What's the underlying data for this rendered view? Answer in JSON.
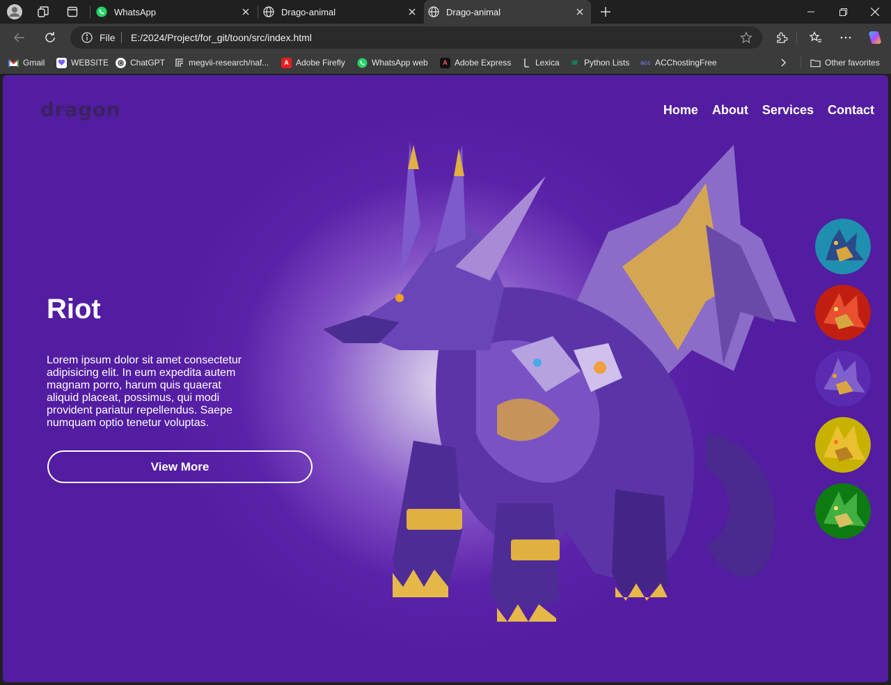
{
  "browser": {
    "tabs": [
      {
        "title": "WhatsApp",
        "icon": "whatsapp-icon",
        "active": false
      },
      {
        "title": "Drago-animal",
        "icon": "globe-icon",
        "active": false
      },
      {
        "title": "Drago-animal",
        "icon": "globe-icon",
        "active": true
      }
    ],
    "omnibox": {
      "scheme_label": "File",
      "url": "E:/2024/Project/for_git/toon/src/index.html"
    },
    "bookmarks": [
      {
        "label": "Gmail",
        "icon": "gmail-icon",
        "color": "#ea4335"
      },
      {
        "label": "WEBSITE",
        "icon": "heart-icon",
        "color": "#7b5cff"
      },
      {
        "label": "ChatGPT",
        "icon": "chatgpt-icon",
        "color": "#ffffff"
      },
      {
        "label": "megvii-research/naf...",
        "icon": "github-icon",
        "color": "#ffffff"
      },
      {
        "label": "Adobe Firefly",
        "icon": "adobe-firefly-icon",
        "color": "#e61e1e"
      },
      {
        "label": "WhatsApp web",
        "icon": "whatsapp-icon",
        "color": "#25d366"
      },
      {
        "label": "Adobe Express",
        "icon": "adobe-express-icon",
        "color": "#111111"
      },
      {
        "label": "Lexica",
        "icon": "lexica-icon",
        "color": "#ffffff"
      },
      {
        "label": "Python Lists",
        "icon": "w3schools-icon",
        "color": "#04aa6d"
      },
      {
        "label": "ACChostingFree",
        "icon": "acc-icon",
        "color": "#6b6bd6"
      }
    ],
    "other_favorites": "Other favorites"
  },
  "page": {
    "logo": "dragon",
    "nav": [
      "Home",
      "About",
      "Services",
      "Contact"
    ],
    "hero": {
      "title": "Riot",
      "description": "Lorem ipsum dolor sit amet consectetur adipisicing elit. In eum expedita autem magnam porro, harum quis quaerat aliquid placeat, possimus, qui modi provident pariatur repellendus. Saepe numquam optio tenetur voluptas.",
      "button": "View More"
    },
    "thumbnails": [
      {
        "name": "blue-dragon-thumbnail",
        "color": "#1f8fb0"
      },
      {
        "name": "red-dragon-thumbnail",
        "color": "#c01e10"
      },
      {
        "name": "purple-dragon-thumbnail",
        "color": "#5a2ab0"
      },
      {
        "name": "yellow-dragon-thumbnail",
        "color": "#c8b200"
      },
      {
        "name": "green-dragon-thumbnail",
        "color": "#0d7a12"
      }
    ],
    "colors": {
      "background": "#521da1",
      "glow": "#e3d8ee",
      "logo": "#3b2262",
      "dragon_body": "#5b35a8",
      "dragon_gold": "#e0b040"
    }
  }
}
